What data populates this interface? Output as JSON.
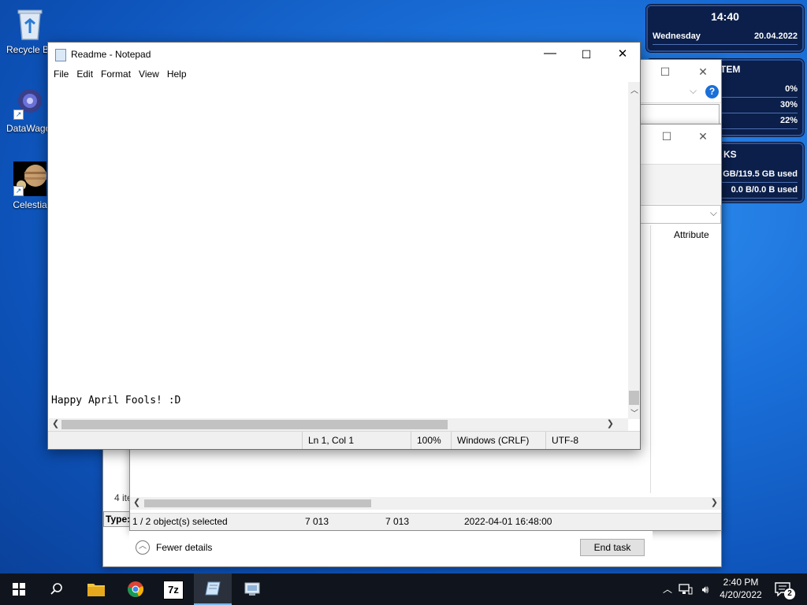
{
  "desktop": {
    "icons": [
      {
        "label": "Recycle Bin"
      },
      {
        "label": "DataWagon"
      },
      {
        "label": "Celestia"
      }
    ]
  },
  "gadgets": {
    "clock": {
      "time": "14:40",
      "day": "Wednesday",
      "date": "20.04.2022"
    },
    "system": {
      "title": "TEM",
      "values": [
        "0%",
        "30%",
        "22%"
      ]
    },
    "disks": {
      "title": "KS",
      "line1": "GB/119.5 GB used",
      "line2": "0.0 B/0.0 B used"
    }
  },
  "bg_window": {
    "column_header": "Attribute",
    "items_count": "4 ite",
    "type_label": "Type:",
    "status": {
      "selected": "1 / 2 object(s) selected",
      "size1": "7 013",
      "size2": "7 013",
      "datetime": "2022-04-01 16:48:00"
    }
  },
  "task_manager": {
    "fewer_details": "Fewer details",
    "end_task": "End task"
  },
  "notepad": {
    "title": "Readme - Notepad",
    "menu": [
      "File",
      "Edit",
      "Format",
      "View",
      "Help"
    ],
    "content": "Happy April Fools! :D",
    "status": {
      "position": "Ln 1, Col 1",
      "zoom": "100%",
      "line_endings": "Windows (CRLF)",
      "encoding": "UTF-8"
    }
  },
  "taskbar": {
    "clock_time": "2:40 PM",
    "clock_date": "4/20/2022",
    "notification_count": "2",
    "apps": [
      {
        "icon": "file-explorer-icon"
      },
      {
        "icon": "chrome-icon"
      },
      {
        "icon": "7zip-icon",
        "label": "7z"
      },
      {
        "icon": "notepad-icon"
      },
      {
        "icon": "system-app-icon"
      }
    ]
  },
  "colors": {
    "gadget_bg": "#0b1f4a",
    "taskbar_bg": "#10151d",
    "accent": "#1a6fd8"
  }
}
